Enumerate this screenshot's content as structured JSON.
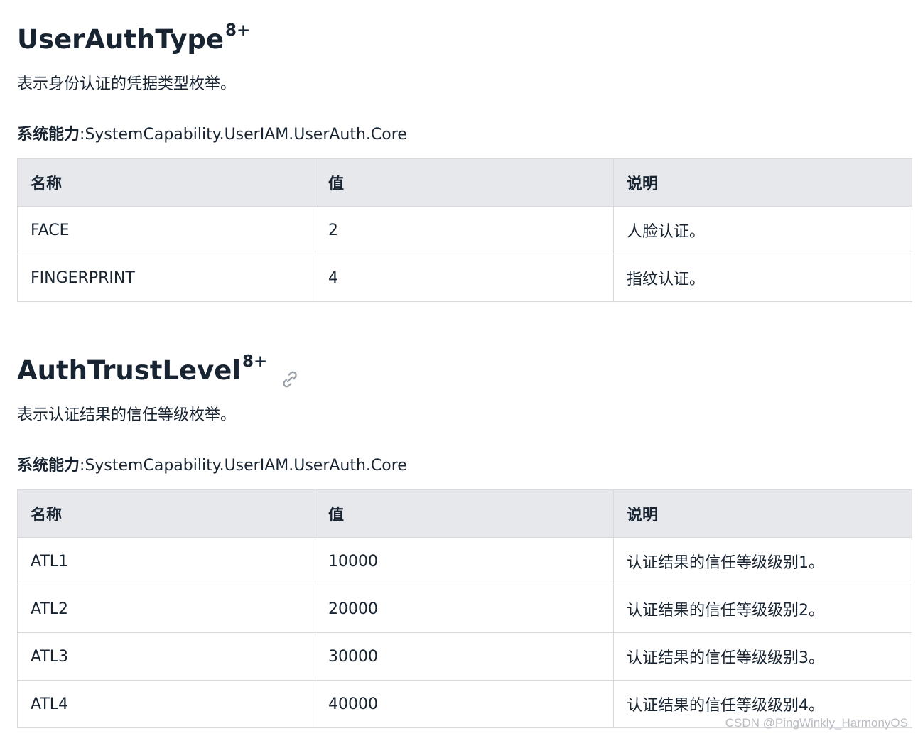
{
  "sections": [
    {
      "title": "UserAuthType",
      "superscript": "8+",
      "description": "表示身份认证的凭据类型枚举。",
      "capability_label": "系统能力",
      "capability_separator": ":",
      "capability_value": "SystemCapability.UserIAM.UserAuth.Core",
      "table": {
        "headers": [
          "名称",
          "值",
          "说明"
        ],
        "rows": [
          [
            "FACE",
            "2",
            "人脸认证。"
          ],
          [
            "FINGERPRINT",
            "4",
            "指纹认证。"
          ]
        ]
      }
    },
    {
      "title": "AuthTrustLevel",
      "superscript": "8+",
      "link_icon": "link-icon",
      "description": "表示认证结果的信任等级枚举。",
      "capability_label": "系统能力",
      "capability_separator": ":",
      "capability_value": "SystemCapability.UserIAM.UserAuth.Core",
      "table": {
        "headers": [
          "名称",
          "值",
          "说明"
        ],
        "rows": [
          [
            "ATL1",
            "10000",
            "认证结果的信任等级级别1。"
          ],
          [
            "ATL2",
            "20000",
            "认证结果的信任等级级别2。"
          ],
          [
            "ATL3",
            "30000",
            "认证结果的信任等级级别3。"
          ],
          [
            "ATL4",
            "40000",
            "认证结果的信任等级级别4。"
          ]
        ]
      }
    }
  ],
  "watermark": "CSDN @PingWinkly_HarmonyOS",
  "colors": {
    "text": "#182431",
    "header_bg": "#e6e8ec",
    "border": "#d7d9dd",
    "watermark": "#b9bcc2"
  }
}
